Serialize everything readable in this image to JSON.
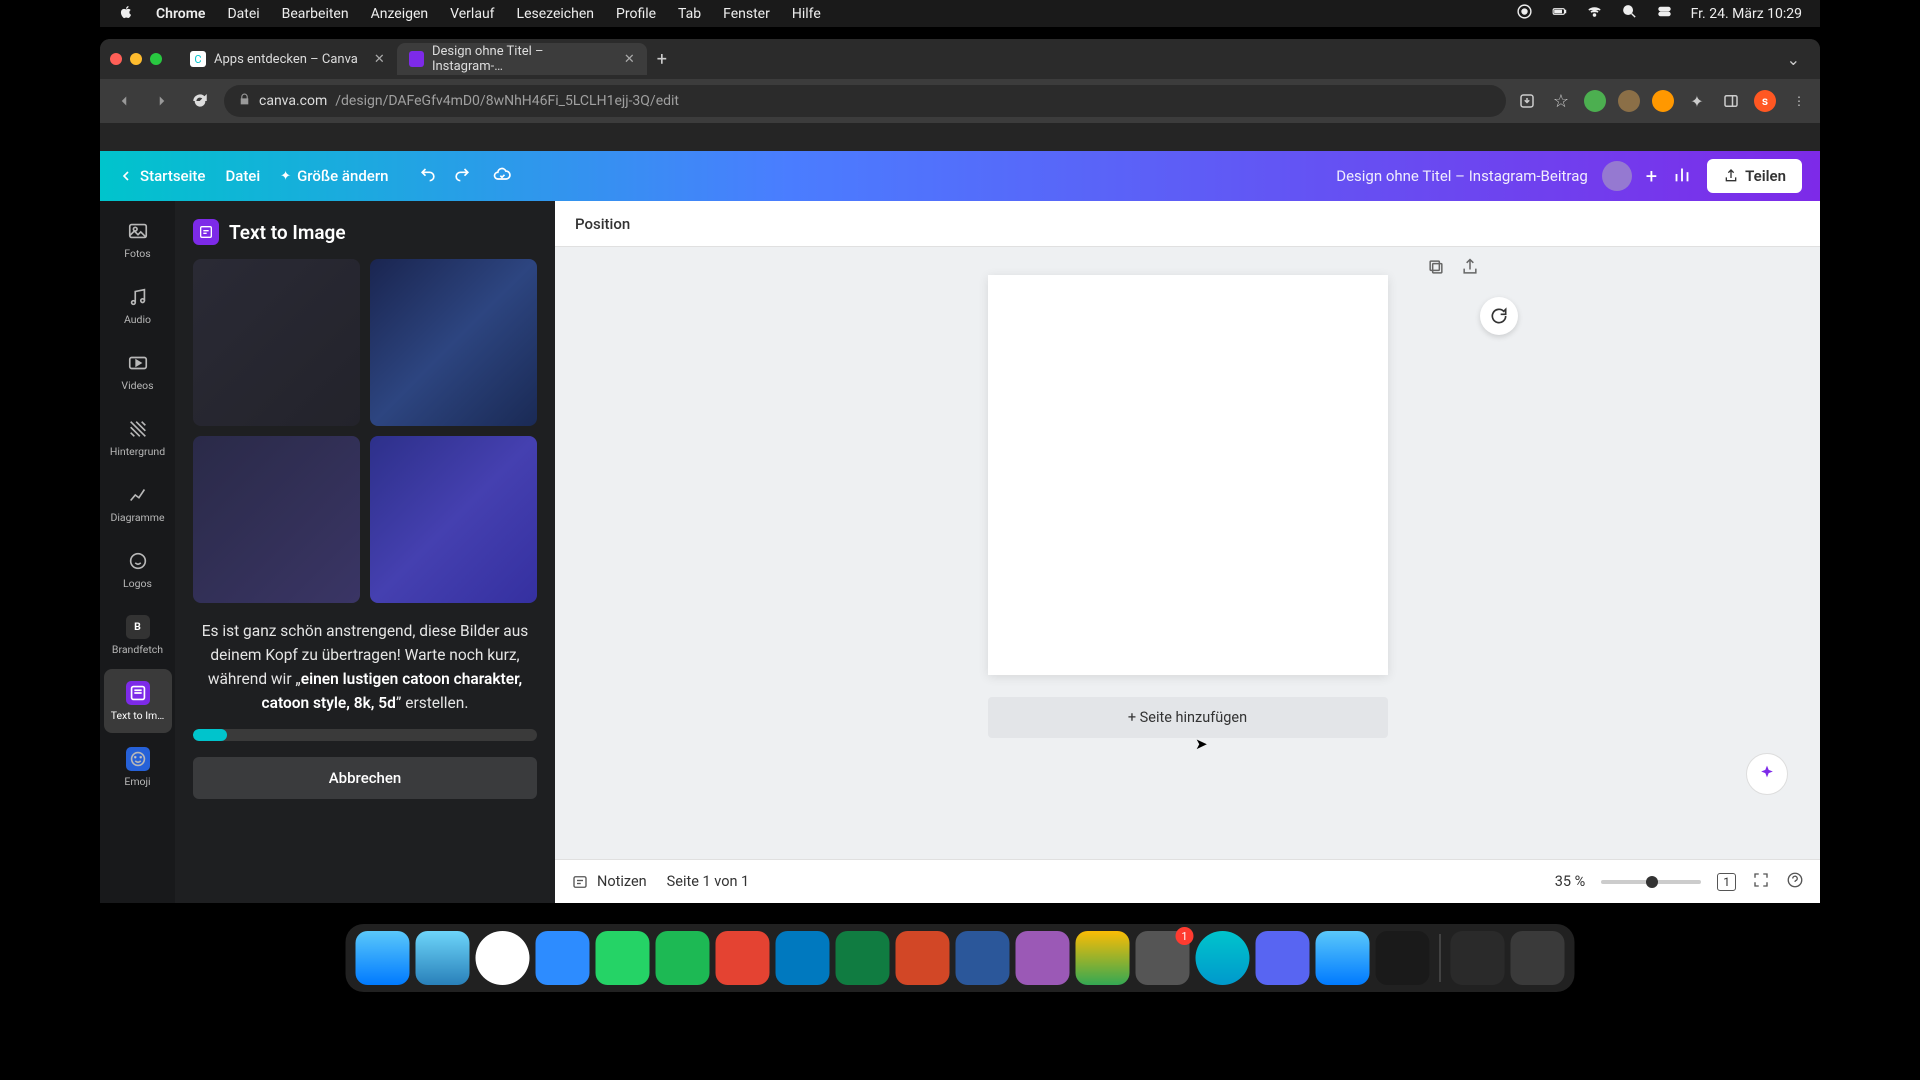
{
  "menubar": {
    "app": "Chrome",
    "items": [
      "Datei",
      "Bearbeiten",
      "Anzeigen",
      "Verlauf",
      "Lesezeichen",
      "Profile",
      "Tab",
      "Fenster",
      "Hilfe"
    ],
    "clock": "Fr. 24. März  10:29"
  },
  "tabs": {
    "t1": "Apps entdecken – Canva",
    "t2": "Design ohne Titel – Instagram-…"
  },
  "url": {
    "host": "canva.com",
    "path": "/design/DAFeGfv4mD0/8wNhH46Fi_5LCLH1ejj-3Q/edit"
  },
  "canva": {
    "home": "Startseite",
    "file": "Datei",
    "resize": "Größe ändern",
    "title": "Design ohne Titel – Instagram-Beitrag",
    "share": "Teilen"
  },
  "rail": {
    "fotos": "Fotos",
    "audio": "Audio",
    "videos": "Videos",
    "hintergrund": "Hintergrund",
    "diagramme": "Diagramme",
    "logos": "Logos",
    "brandfetch": "Brandfetch",
    "texttoimg": "Text to Im…",
    "emoji": "Emoji"
  },
  "panel": {
    "title": "Text to Image",
    "text1": "Es ist ganz schön anstrengend, diese Bilder aus deinem Kopf zu übertragen! Warte noch kurz, während wir „",
    "bold": "einen lustigen catoon charakter, catoon style, 8k, 5d",
    "text2": "” erstellen.",
    "cancel": "Abbrechen"
  },
  "ctx": {
    "position": "Position"
  },
  "canvas": {
    "addpage": "+ Seite hinzufügen"
  },
  "bottom": {
    "notes": "Notizen",
    "page": "Seite 1 von 1",
    "zoom": "35 %",
    "pagecount": "1"
  },
  "dock": {
    "badge": "1"
  }
}
